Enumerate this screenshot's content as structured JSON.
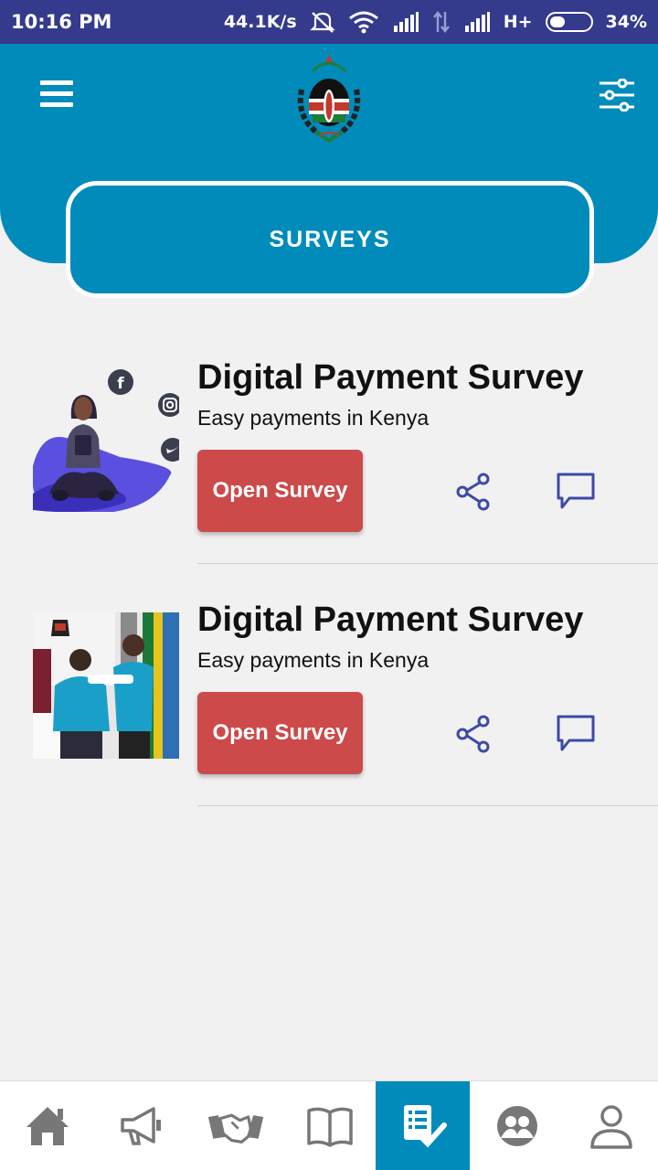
{
  "status_bar": {
    "time": "10:16 PM",
    "net_speed": "44.1K/s",
    "network_type": "H+",
    "battery_percent": "34%",
    "battery_level": 0.34,
    "icons": [
      "mute-icon",
      "wifi-icon",
      "signal-icon",
      "data-arrows-icon",
      "signal-icon"
    ]
  },
  "header": {
    "left_icon": "menu-icon",
    "right_icon": "filter-sliders-icon",
    "logo": "coat-of-arms-logo",
    "tab_label": "SURVEYS"
  },
  "surveys": [
    {
      "title": "Digital Payment Survey",
      "subtitle": "Easy payments in Kenya",
      "button_label": "Open Survey",
      "image": "illustration-woman-with-tablet",
      "icons": [
        "share-icon",
        "comment-icon"
      ]
    },
    {
      "title": "Digital Payment Survey",
      "subtitle": "Easy payments in Kenya",
      "button_label": "Open Survey",
      "image": "photo-people-in-blue-shirts",
      "icons": [
        "share-icon",
        "comment-icon"
      ]
    }
  ],
  "bottom_nav": {
    "items": [
      "home-icon",
      "megaphone-icon",
      "handshake-icon",
      "book-icon",
      "survey-checklist-icon",
      "group-icon",
      "profile-icon"
    ],
    "active_index": 4
  },
  "colors": {
    "status_bar": "#343a8c",
    "primary": "#008bbb",
    "button": "#cc4a4a",
    "icon_accent": "#3d4aa6",
    "background": "#f1f1f1"
  }
}
